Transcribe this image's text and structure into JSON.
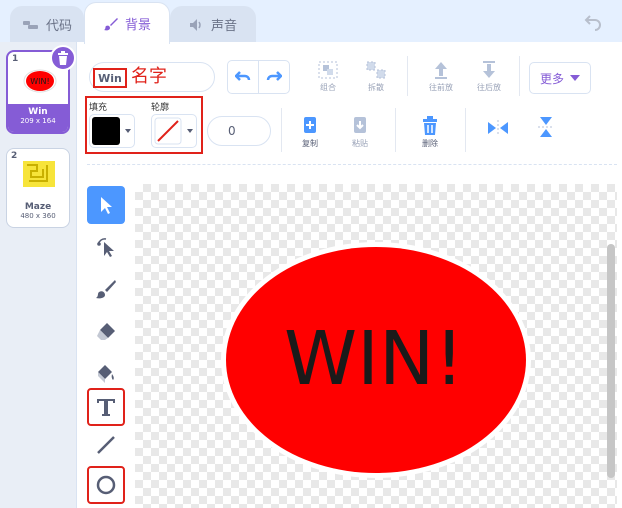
{
  "tabs": [
    {
      "label": "代码",
      "icon": "code-icon"
    },
    {
      "label": "背景",
      "icon": "brush-icon"
    },
    {
      "label": "声音",
      "icon": "speaker-icon"
    }
  ],
  "costumes": [
    {
      "number": "1",
      "name": "Win",
      "size": "209 x 164",
      "thumb_text": "WIN!",
      "selected": true
    },
    {
      "number": "2",
      "name": "Maze",
      "size": "480 x 360",
      "selected": false
    }
  ],
  "editor": {
    "name_value": "Win",
    "name_annotation": "名字",
    "group_label": "组合",
    "ungroup_label": "拆散",
    "forward_label": "往前放",
    "backward_label": "往后放",
    "more_label": "更多",
    "fill_label": "填充",
    "outline_label": "轮廓",
    "outline_size": "0",
    "copy_label": "复制",
    "paste_label": "粘贴",
    "delete_label": "删除"
  },
  "canvas": {
    "text": "WIN!",
    "shape_color": "#ff0000",
    "text_color": "#1a1a1a"
  },
  "colors": {
    "accent": "#855cd6",
    "selected_tool": "#4c97ff",
    "annotation_red": "#e0221a",
    "fill_swatch": "#000000"
  },
  "tools": [
    "select",
    "reshape",
    "brush",
    "eraser",
    "fill",
    "text",
    "line",
    "circle"
  ]
}
